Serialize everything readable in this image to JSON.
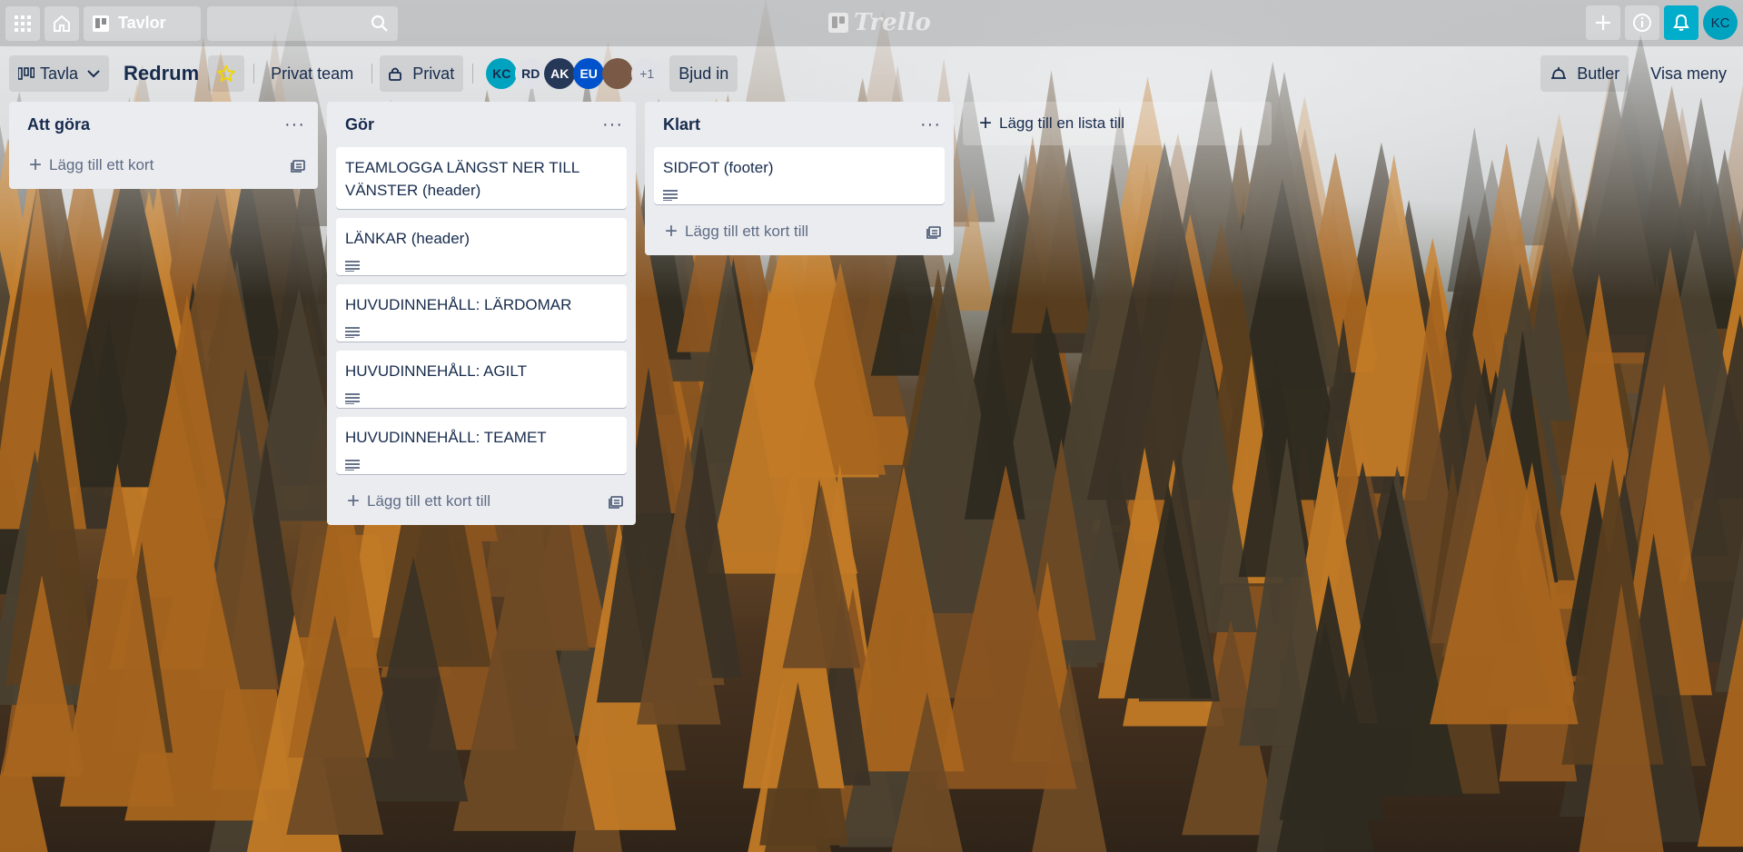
{
  "topnav": {
    "boards_label": "Tavlor",
    "search_placeholder": "",
    "logo_text": "Trello",
    "user_initials": "KC",
    "icons": [
      "apps-grid-icon",
      "home-icon",
      "board-icon",
      "search-icon",
      "plus-icon",
      "info-icon",
      "bell-icon"
    ]
  },
  "header": {
    "view_label": "Tavla",
    "board_name": "Redrum",
    "team_label": "Privat team",
    "visibility_label": "Privat",
    "invite_label": "Bjud in",
    "butler_label": "Butler",
    "menu_label": "Visa meny",
    "members": [
      {
        "initials": "KC",
        "color": "#00a3bf",
        "text": "#172b4d"
      },
      {
        "initials": "RD",
        "color": "#dfe1e6",
        "text": "#172b4d"
      },
      {
        "initials": "AK",
        "color": "#253858",
        "text": "#ffffff"
      },
      {
        "initials": "EU",
        "color": "#0052cc",
        "text": "#ffffff"
      },
      {
        "initials": "",
        "color": "#7a5a46",
        "text": "#ffffff"
      }
    ],
    "extra_members": "+1"
  },
  "lists": [
    {
      "title": "Att göra",
      "cards": [],
      "add_label": "Lägg till ett kort"
    },
    {
      "title": "Gör",
      "cards": [
        {
          "title": "TEAMLOGGA LÄNGST NER TILL VÄNSTER (header)",
          "has_description": false
        },
        {
          "title": "LÄNKAR (header)",
          "has_description": true
        },
        {
          "title": "HUVUDINNEHÅLL: LÄRDOMAR",
          "has_description": true
        },
        {
          "title": "HUVUDINNEHÅLL: AGILT",
          "has_description": true
        },
        {
          "title": "HUVUDINNEHÅLL: TEAMET",
          "has_description": true
        }
      ],
      "add_label": "Lägg till ett kort till"
    },
    {
      "title": "Klart",
      "cards": [
        {
          "title": "SIDFOT (footer)",
          "has_description": true
        }
      ],
      "add_label": "Lägg till ett kort till"
    }
  ],
  "add_list_label": "Lägg till en lista till",
  "colors": {
    "accent": "#00aecc",
    "star": "#f2d600",
    "list_bg": "#ebecf0"
  }
}
